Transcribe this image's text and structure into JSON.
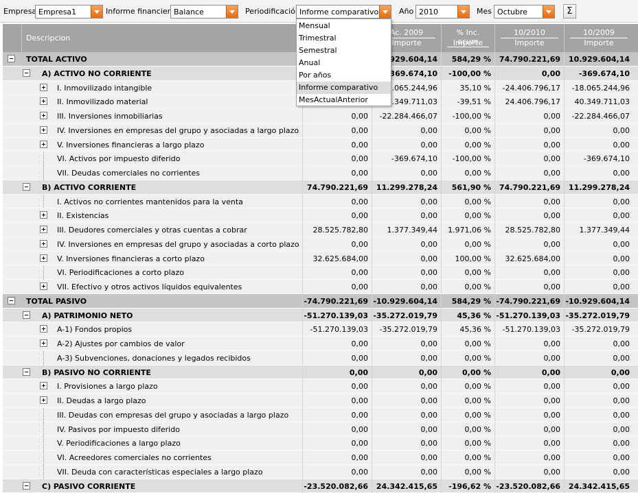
{
  "toolbar": {
    "empresa_label": "Empresa",
    "empresa_value": "Empresa1",
    "informe_label": "Informe financiero",
    "informe_value": "Balance",
    "periodificacion_label": "Periodificación",
    "periodificacion_value": "Informe comparativo",
    "anio_label": "Año",
    "anio_value": "2010",
    "mes_label": "Mes",
    "mes_value": "Octubre",
    "sum_glyph": "Σ"
  },
  "dropdown": {
    "items": [
      "Mensual",
      "Trimestral",
      "Semestral",
      "Anual",
      "Por años",
      "Informe comparativo",
      "MesActualAnterior"
    ],
    "selected_index": 5
  },
  "header": {
    "descripcion": "Descripcion",
    "columns": [
      {
        "top": "",
        "bottom": ""
      },
      {
        "top": "Ac. 2009",
        "bottom": "Importe"
      },
      {
        "top": "% Inc. acum",
        "bottom": "Importe"
      },
      {
        "top": "10/2010",
        "bottom": "Importe"
      },
      {
        "top": "10/2009",
        "bottom": "Importe"
      }
    ]
  },
  "rows": [
    {
      "level": 0,
      "exp": "minus",
      "label": "TOTAL ACTIVO",
      "v": [
        "",
        "10.929.604,14",
        "584,29 %",
        "74.790.221,69",
        "10.929.604,14"
      ]
    },
    {
      "level": 1,
      "exp": "minus",
      "label": "A) ACTIVO NO CORRIENTE",
      "v": [
        "",
        "-369.674,10",
        "-100,00 %",
        "0,00",
        "-369.674,10"
      ]
    },
    {
      "level": 2,
      "exp": "plus",
      "label": "I. Inmovilizado intangible",
      "v": [
        "",
        "-18.065.244,96",
        "35,10 %",
        "-24.406.796,17",
        "-18.065.244,96"
      ]
    },
    {
      "level": 2,
      "exp": "plus",
      "label": "II. Inmovilizado material",
      "v": [
        "",
        "40.349.711,03",
        "-39,51 %",
        "24.406.796,17",
        "40.349.711,03"
      ]
    },
    {
      "level": 2,
      "exp": "plus",
      "label": "III. Inversiones inmobiliarias",
      "v": [
        "0,00",
        "-22.284.466,07",
        "-100,00 %",
        "0,00",
        "-22.284.466,07"
      ]
    },
    {
      "level": 2,
      "exp": "plus",
      "label": "IV. Inversiones en empresas del grupo y asociadas a largo plazo",
      "v": [
        "0,00",
        "0,00",
        "0,00 %",
        "0,00",
        "0,00"
      ]
    },
    {
      "level": 2,
      "exp": "plus",
      "label": "V. Inversiones financieras a largo plazo",
      "v": [
        "0,00",
        "0,00",
        "0,00 %",
        "0,00",
        "0,00"
      ]
    },
    {
      "level": 2,
      "exp": "none",
      "label": "VI. Activos por impuesto diferido",
      "v": [
        "0,00",
        "-369.674,10",
        "-100,00 %",
        "0,00",
        "-369.674,10"
      ]
    },
    {
      "level": 2,
      "exp": "none",
      "label": "VII. Deudas comerciales no corrientes",
      "v": [
        "0,00",
        "0,00",
        "0,00 %",
        "0,00",
        "0,00"
      ]
    },
    {
      "level": 1,
      "exp": "minus",
      "label": "B) ACTIVO CORRIENTE",
      "v": [
        "74.790.221,69",
        "11.299.278,24",
        "561,90 %",
        "74.790.221,69",
        "11.299.278,24"
      ]
    },
    {
      "level": 2,
      "exp": "none",
      "label": "I. Activos no corrientes mantenidos para la venta",
      "v": [
        "0,00",
        "0,00",
        "0,00 %",
        "0,00",
        "0,00"
      ]
    },
    {
      "level": 2,
      "exp": "plus",
      "label": "II. Existencias",
      "v": [
        "0,00",
        "0,00",
        "0,00 %",
        "0,00",
        "0,00"
      ]
    },
    {
      "level": 2,
      "exp": "plus",
      "label": "III. Deudores comerciales y otras cuentas a cobrar",
      "v": [
        "28.525.782,80",
        "1.377.349,44",
        "1.971,06 %",
        "28.525.782,80",
        "1.377.349,44"
      ]
    },
    {
      "level": 2,
      "exp": "plus",
      "label": "IV. Inversiones en empresas del grupo y asociadas a corto plazo",
      "v": [
        "0,00",
        "0,00",
        "0,00 %",
        "0,00",
        "0,00"
      ]
    },
    {
      "level": 2,
      "exp": "plus",
      "label": "V. Inversiones financieras a corto plazo",
      "v": [
        "32.625.684,00",
        "0,00",
        "100,00 %",
        "32.625.684,00",
        "0,00"
      ]
    },
    {
      "level": 2,
      "exp": "none",
      "label": "VI. Periodificaciones a corto plazo",
      "v": [
        "0,00",
        "0,00",
        "0,00 %",
        "0,00",
        "0,00"
      ]
    },
    {
      "level": 2,
      "exp": "plus",
      "label": "VII. Efectivo y otros activos líquidos equivalentes",
      "v": [
        "0,00",
        "0,00",
        "0,00 %",
        "0,00",
        "0,00"
      ]
    },
    {
      "level": 0,
      "exp": "minus",
      "label": "TOTAL PASIVO",
      "v": [
        "-74.790.221,69",
        "-10.929.604,14",
        "584,29 %",
        "-74.790.221,69",
        "-10.929.604,14"
      ]
    },
    {
      "level": 1,
      "exp": "minus",
      "label": "A) PATRIMONIO NETO",
      "v": [
        "-51.270.139,03",
        "-35.272.019,79",
        "45,36 %",
        "-51.270.139,03",
        "-35.272.019,79"
      ]
    },
    {
      "level": 2,
      "exp": "plus",
      "label": "A-1) Fondos propios",
      "v": [
        "-51.270.139,03",
        "-35.272.019,79",
        "45,36 %",
        "-51.270.139,03",
        "-35.272.019,79"
      ]
    },
    {
      "level": 2,
      "exp": "plus",
      "label": "A-2) Ajustes por cambios de valor",
      "v": [
        "0,00",
        "0,00",
        "0,00 %",
        "0,00",
        "0,00"
      ]
    },
    {
      "level": 2,
      "exp": "none",
      "label": "A-3) Subvenciones, donaciones y legados recibidos",
      "v": [
        "0,00",
        "0,00",
        "0,00 %",
        "0,00",
        "0,00"
      ]
    },
    {
      "level": 1,
      "exp": "minus",
      "label": "B) PASIVO NO CORRIENTE",
      "v": [
        "0,00",
        "0,00",
        "0,00 %",
        "0,00",
        "0,00"
      ]
    },
    {
      "level": 2,
      "exp": "plus",
      "label": "I. Provisiones a largo plazo",
      "v": [
        "0,00",
        "0,00",
        "0,00 %",
        "0,00",
        "0,00"
      ]
    },
    {
      "level": 2,
      "exp": "plus",
      "label": "II. Deudas a largo plazo",
      "v": [
        "0,00",
        "0,00",
        "0,00 %",
        "0,00",
        "0,00"
      ]
    },
    {
      "level": 2,
      "exp": "none",
      "label": "III. Deudas con empresas del grupo y asociadas a largo plazo",
      "v": [
        "0,00",
        "0,00",
        "0,00 %",
        "0,00",
        "0,00"
      ]
    },
    {
      "level": 2,
      "exp": "none",
      "label": "IV. Pasivos por impuesto diferido",
      "v": [
        "0,00",
        "0,00",
        "0,00 %",
        "0,00",
        "0,00"
      ]
    },
    {
      "level": 2,
      "exp": "none",
      "label": "V. Periodificaciones a largo plazo",
      "v": [
        "0,00",
        "0,00",
        "0,00 %",
        "0,00",
        "0,00"
      ]
    },
    {
      "level": 2,
      "exp": "none",
      "label": "VI. Acreedores comerciales no corrientes",
      "v": [
        "0,00",
        "0,00",
        "0,00 %",
        "0,00",
        "0,00"
      ]
    },
    {
      "level": 2,
      "exp": "none",
      "label": "VII. Deuda con características especiales a largo plazo",
      "v": [
        "0,00",
        "0,00",
        "0,00 %",
        "0,00",
        "0,00"
      ]
    },
    {
      "level": 1,
      "exp": "minus",
      "label": "C) PASIVO CORRIENTE",
      "v": [
        "-23.520.082,66",
        "24.342.415,65",
        "-196,62 %",
        "-23.520.082,66",
        "24.342.415,65"
      ]
    }
  ]
}
